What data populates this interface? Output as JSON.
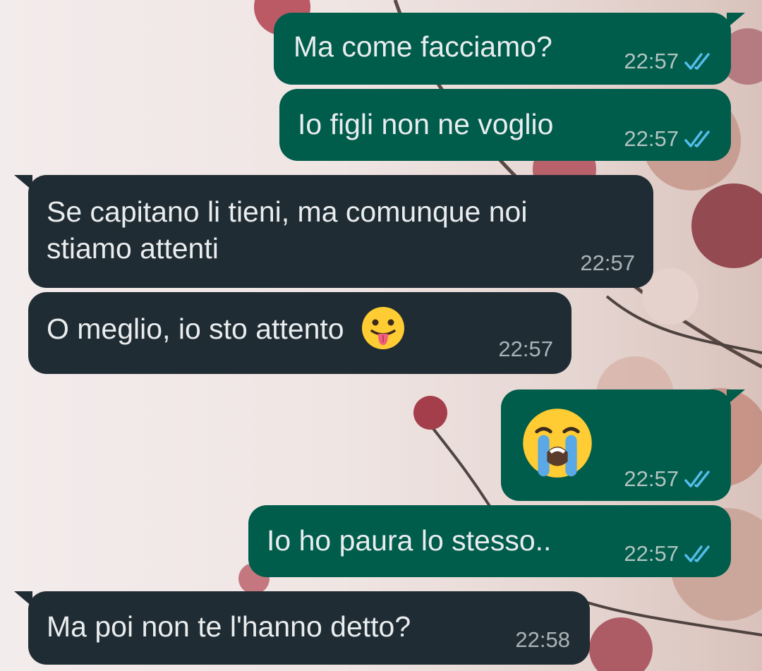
{
  "chat": {
    "messages": [
      {
        "direction": "outgoing",
        "text": "Ma come facciamo?",
        "time": "22:57",
        "status": "read",
        "status_icon": "double-check-icon"
      },
      {
        "direction": "outgoing",
        "text": "Io figli non ne voglio",
        "time": "22:57",
        "status": "read",
        "status_icon": "double-check-icon"
      },
      {
        "direction": "incoming",
        "text": "Se capitano li tieni, ma comunque noi stiamo attenti",
        "time": "22:57"
      },
      {
        "direction": "incoming",
        "text": "O meglio, io sto attento",
        "emoji": "face-with-tongue-emoji",
        "time": "22:57"
      },
      {
        "direction": "outgoing",
        "emoji": "loudly-crying-face-emoji",
        "time": "22:57",
        "status": "read",
        "status_icon": "double-check-icon"
      },
      {
        "direction": "outgoing",
        "text": "Io ho paura lo stesso..",
        "time": "22:57",
        "status": "read",
        "status_icon": "double-check-icon"
      },
      {
        "direction": "incoming",
        "text": "Ma poi non te l'hanno detto?",
        "time": "22:58"
      }
    ]
  },
  "colors": {
    "outgoing_bubble": "#005c4b",
    "incoming_bubble": "#202c33",
    "message_text": "#e9edef",
    "read_ticks": "#53bdeb"
  }
}
